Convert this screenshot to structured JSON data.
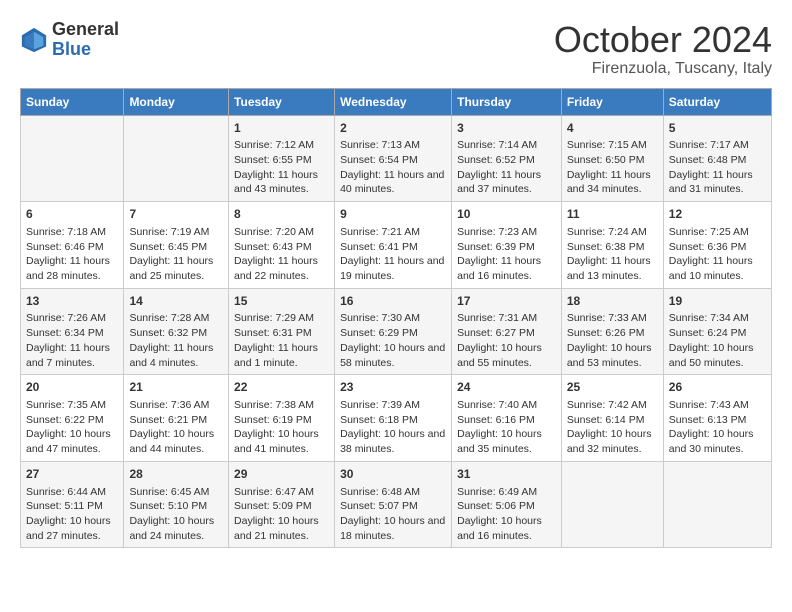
{
  "logo": {
    "general": "General",
    "blue": "Blue"
  },
  "title": "October 2024",
  "location": "Firenzuola, Tuscany, Italy",
  "days_of_week": [
    "Sunday",
    "Monday",
    "Tuesday",
    "Wednesday",
    "Thursday",
    "Friday",
    "Saturday"
  ],
  "weeks": [
    [
      {
        "day": "",
        "info": ""
      },
      {
        "day": "",
        "info": ""
      },
      {
        "day": "1",
        "info": "Sunrise: 7:12 AM\nSunset: 6:55 PM\nDaylight: 11 hours and 43 minutes."
      },
      {
        "day": "2",
        "info": "Sunrise: 7:13 AM\nSunset: 6:54 PM\nDaylight: 11 hours and 40 minutes."
      },
      {
        "day": "3",
        "info": "Sunrise: 7:14 AM\nSunset: 6:52 PM\nDaylight: 11 hours and 37 minutes."
      },
      {
        "day": "4",
        "info": "Sunrise: 7:15 AM\nSunset: 6:50 PM\nDaylight: 11 hours and 34 minutes."
      },
      {
        "day": "5",
        "info": "Sunrise: 7:17 AM\nSunset: 6:48 PM\nDaylight: 11 hours and 31 minutes."
      }
    ],
    [
      {
        "day": "6",
        "info": "Sunrise: 7:18 AM\nSunset: 6:46 PM\nDaylight: 11 hours and 28 minutes."
      },
      {
        "day": "7",
        "info": "Sunrise: 7:19 AM\nSunset: 6:45 PM\nDaylight: 11 hours and 25 minutes."
      },
      {
        "day": "8",
        "info": "Sunrise: 7:20 AM\nSunset: 6:43 PM\nDaylight: 11 hours and 22 minutes."
      },
      {
        "day": "9",
        "info": "Sunrise: 7:21 AM\nSunset: 6:41 PM\nDaylight: 11 hours and 19 minutes."
      },
      {
        "day": "10",
        "info": "Sunrise: 7:23 AM\nSunset: 6:39 PM\nDaylight: 11 hours and 16 minutes."
      },
      {
        "day": "11",
        "info": "Sunrise: 7:24 AM\nSunset: 6:38 PM\nDaylight: 11 hours and 13 minutes."
      },
      {
        "day": "12",
        "info": "Sunrise: 7:25 AM\nSunset: 6:36 PM\nDaylight: 11 hours and 10 minutes."
      }
    ],
    [
      {
        "day": "13",
        "info": "Sunrise: 7:26 AM\nSunset: 6:34 PM\nDaylight: 11 hours and 7 minutes."
      },
      {
        "day": "14",
        "info": "Sunrise: 7:28 AM\nSunset: 6:32 PM\nDaylight: 11 hours and 4 minutes."
      },
      {
        "day": "15",
        "info": "Sunrise: 7:29 AM\nSunset: 6:31 PM\nDaylight: 11 hours and 1 minute."
      },
      {
        "day": "16",
        "info": "Sunrise: 7:30 AM\nSunset: 6:29 PM\nDaylight: 10 hours and 58 minutes."
      },
      {
        "day": "17",
        "info": "Sunrise: 7:31 AM\nSunset: 6:27 PM\nDaylight: 10 hours and 55 minutes."
      },
      {
        "day": "18",
        "info": "Sunrise: 7:33 AM\nSunset: 6:26 PM\nDaylight: 10 hours and 53 minutes."
      },
      {
        "day": "19",
        "info": "Sunrise: 7:34 AM\nSunset: 6:24 PM\nDaylight: 10 hours and 50 minutes."
      }
    ],
    [
      {
        "day": "20",
        "info": "Sunrise: 7:35 AM\nSunset: 6:22 PM\nDaylight: 10 hours and 47 minutes."
      },
      {
        "day": "21",
        "info": "Sunrise: 7:36 AM\nSunset: 6:21 PM\nDaylight: 10 hours and 44 minutes."
      },
      {
        "day": "22",
        "info": "Sunrise: 7:38 AM\nSunset: 6:19 PM\nDaylight: 10 hours and 41 minutes."
      },
      {
        "day": "23",
        "info": "Sunrise: 7:39 AM\nSunset: 6:18 PM\nDaylight: 10 hours and 38 minutes."
      },
      {
        "day": "24",
        "info": "Sunrise: 7:40 AM\nSunset: 6:16 PM\nDaylight: 10 hours and 35 minutes."
      },
      {
        "day": "25",
        "info": "Sunrise: 7:42 AM\nSunset: 6:14 PM\nDaylight: 10 hours and 32 minutes."
      },
      {
        "day": "26",
        "info": "Sunrise: 7:43 AM\nSunset: 6:13 PM\nDaylight: 10 hours and 30 minutes."
      }
    ],
    [
      {
        "day": "27",
        "info": "Sunrise: 6:44 AM\nSunset: 5:11 PM\nDaylight: 10 hours and 27 minutes."
      },
      {
        "day": "28",
        "info": "Sunrise: 6:45 AM\nSunset: 5:10 PM\nDaylight: 10 hours and 24 minutes."
      },
      {
        "day": "29",
        "info": "Sunrise: 6:47 AM\nSunset: 5:09 PM\nDaylight: 10 hours and 21 minutes."
      },
      {
        "day": "30",
        "info": "Sunrise: 6:48 AM\nSunset: 5:07 PM\nDaylight: 10 hours and 18 minutes."
      },
      {
        "day": "31",
        "info": "Sunrise: 6:49 AM\nSunset: 5:06 PM\nDaylight: 10 hours and 16 minutes."
      },
      {
        "day": "",
        "info": ""
      },
      {
        "day": "",
        "info": ""
      }
    ]
  ]
}
